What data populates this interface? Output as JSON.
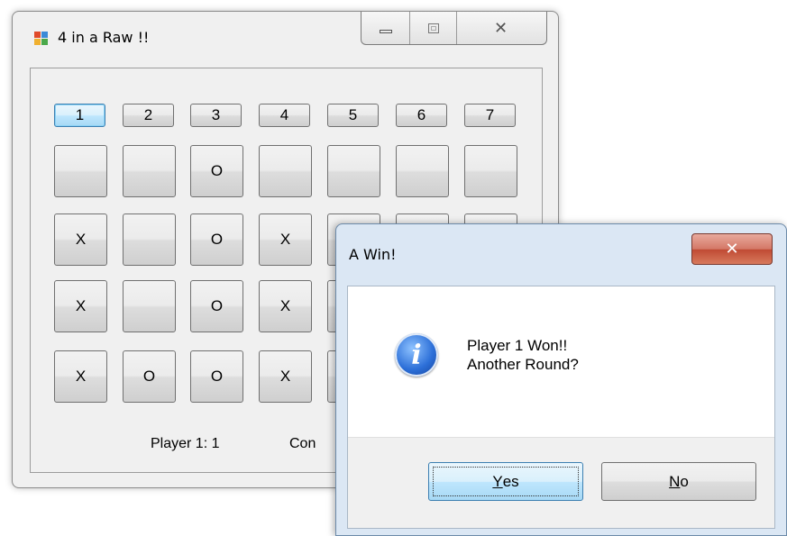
{
  "window": {
    "title": "4 in a Raw !!",
    "caption_icons": [
      "minimize-icon",
      "maximize-icon",
      "close-icon"
    ]
  },
  "column_buttons": [
    "1",
    "2",
    "3",
    "4",
    "5",
    "6",
    "7"
  ],
  "board": [
    [
      "",
      "",
      "O",
      "",
      "",
      "",
      ""
    ],
    [
      "X",
      "",
      "O",
      "X",
      "",
      "",
      ""
    ],
    [
      "X",
      "",
      "O",
      "X",
      "",
      "",
      ""
    ],
    [
      "X",
      "O",
      "O",
      "X",
      "",
      "",
      ""
    ]
  ],
  "score": {
    "player1": "Player 1: 1",
    "other_partial": "Con"
  },
  "dialog": {
    "title": "A Win!",
    "icon": "info-icon",
    "message_line1": "Player 1 Won!!",
    "message_line2": "Another Round?",
    "yes": {
      "mnemonic": "Y",
      "rest": "es"
    },
    "no": {
      "mnemonic": "N",
      "rest": "o"
    }
  }
}
